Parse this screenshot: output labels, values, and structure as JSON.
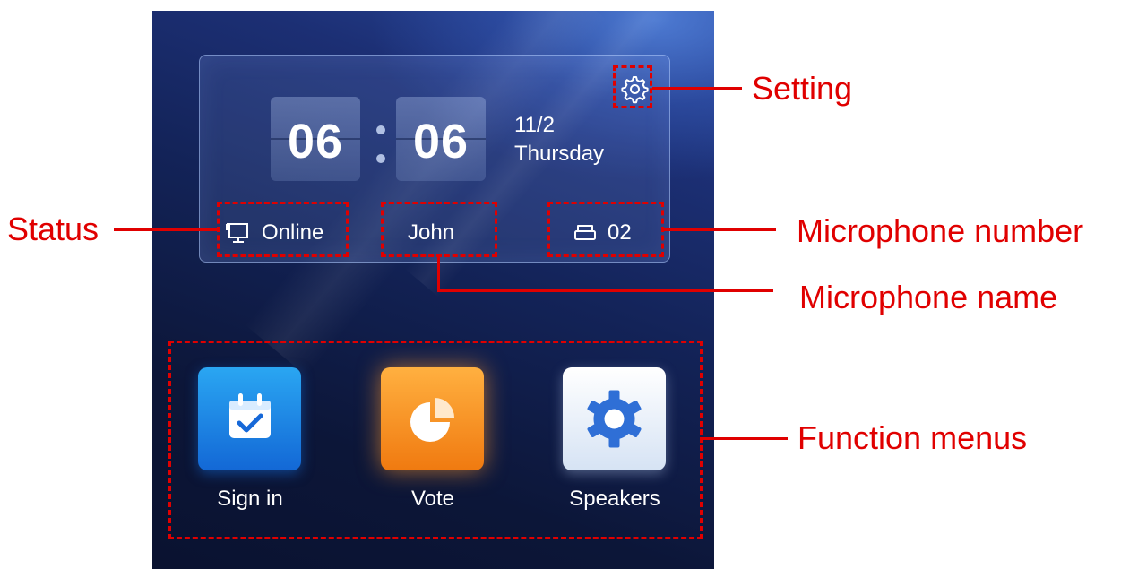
{
  "colors": {
    "accent": "#e00000",
    "screen_bg": "#132358",
    "signin_tile": "#1e88e5",
    "vote_tile": "#f59a23",
    "speakers_tile": "#e9f0fa"
  },
  "clock": {
    "hour": "06",
    "minute": "06",
    "date": "11/2",
    "weekday": "Thursday"
  },
  "status_bar": {
    "status_icon": "monitor-icon",
    "status": "Online",
    "mic_name": "John",
    "mic_icon": "microphone-seat-icon",
    "mic_number": "02"
  },
  "settings": {
    "icon": "gear-icon"
  },
  "menus": [
    {
      "label": "Sign in",
      "icon": "calendar-check-icon"
    },
    {
      "label": "Vote",
      "icon": "pie-chart-icon"
    },
    {
      "label": "Speakers",
      "icon": "gear-icon"
    }
  ],
  "callouts": {
    "setting": "Setting",
    "status": "Status",
    "mic_number": "Microphone number",
    "mic_name": "Microphone name",
    "function_menus": "Function menus"
  }
}
